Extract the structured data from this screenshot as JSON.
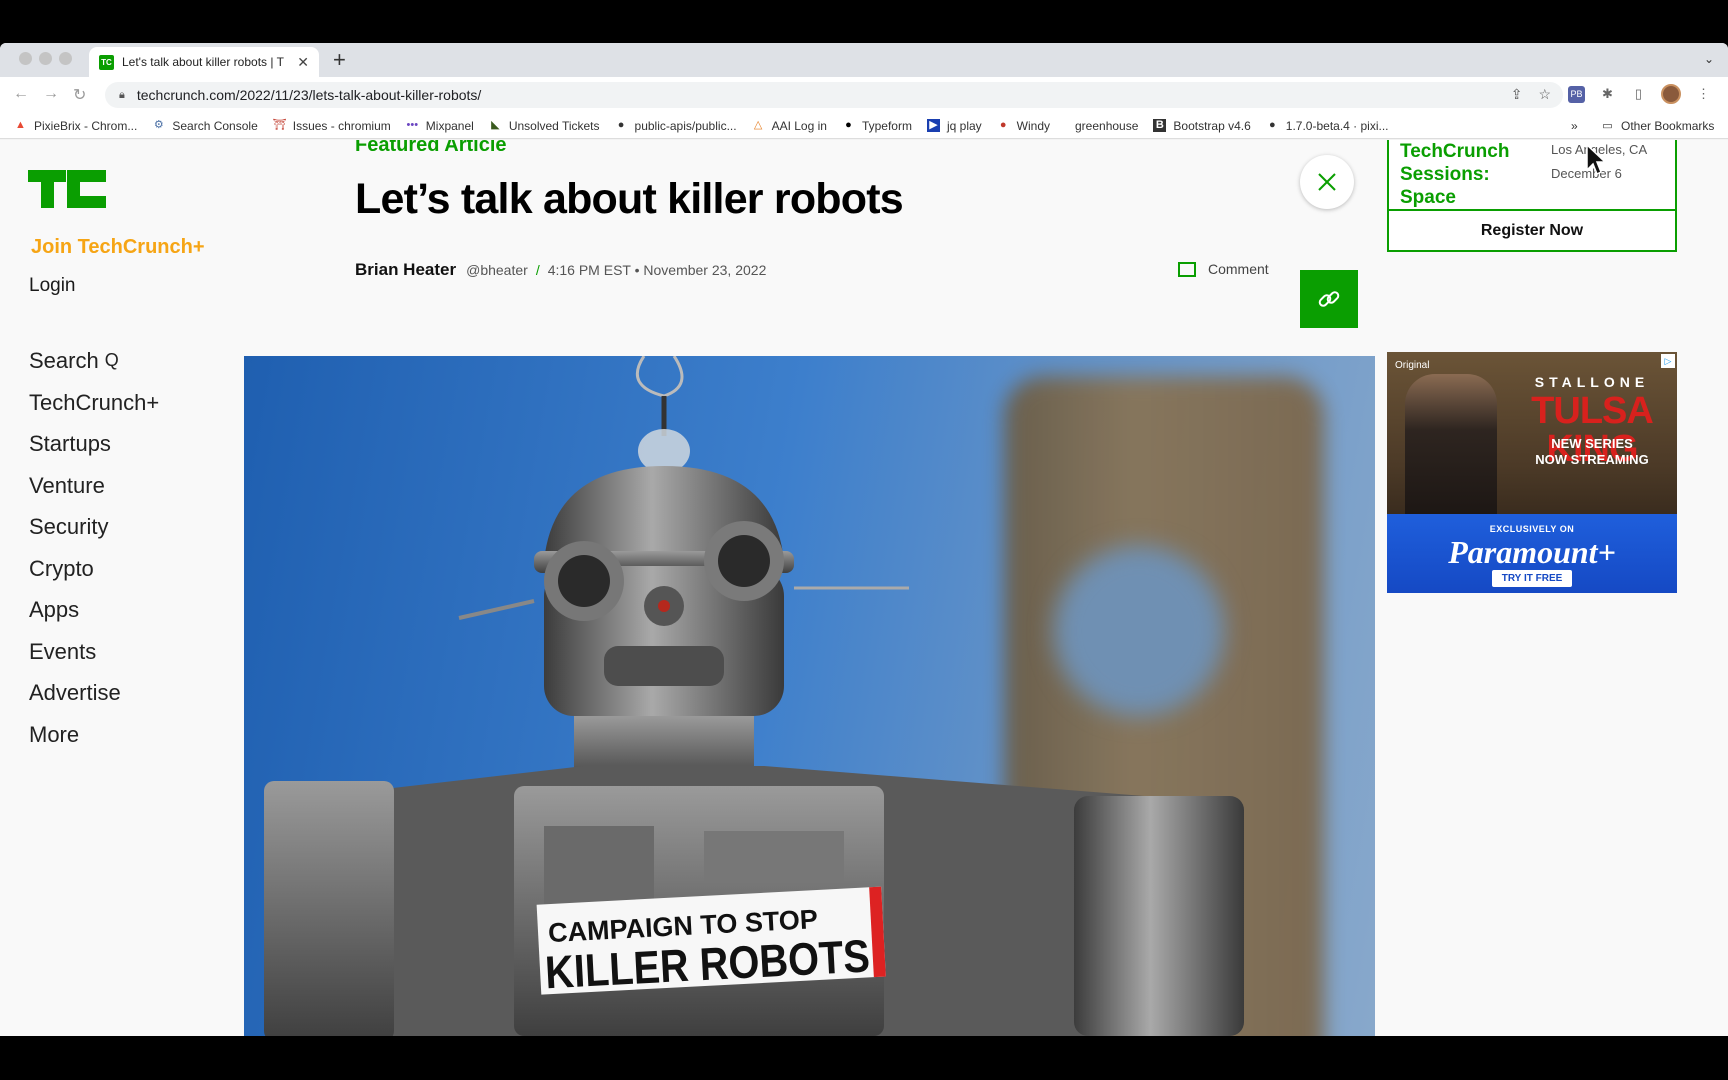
{
  "browser": {
    "tab_title": "Let's talk about killer robots | T",
    "tab_favicon": "TC",
    "url": "techcrunch.com/2022/11/23/lets-talk-about-killer-robots/",
    "bookmarks": [
      {
        "label": "PixieBrix - Chrom...",
        "icon": "pixiebrix-icon"
      },
      {
        "label": "Search Console",
        "icon": "search-console-icon"
      },
      {
        "label": "Issues - chromium",
        "icon": "chromium-issues-icon"
      },
      {
        "label": "Mixpanel",
        "icon": "mixpanel-icon"
      },
      {
        "label": "Unsolved Tickets",
        "icon": "zendesk-icon"
      },
      {
        "label": "public-apis/public...",
        "icon": "github-icon"
      },
      {
        "label": "AAI Log in",
        "icon": "aai-icon"
      },
      {
        "label": "Typeform",
        "icon": "typeform-icon"
      },
      {
        "label": "jq play",
        "icon": "jq-play-icon"
      },
      {
        "label": "Windy",
        "icon": "windy-icon"
      },
      {
        "label": "greenhouse",
        "icon": ""
      },
      {
        "label": "Bootstrap v4.6",
        "icon": "bootstrap-icon"
      },
      {
        "label": "1.7.0-beta.4 · pixi...",
        "icon": "github-icon"
      }
    ],
    "bookmarks_overflow": "»",
    "other_bookmarks": "Other Bookmarks"
  },
  "sidebar": {
    "join": "Join TechCrunch+",
    "login": "Login",
    "nav": [
      {
        "label": "Search",
        "icon": "search-icon"
      },
      {
        "label": "TechCrunch+"
      },
      {
        "label": "Startups"
      },
      {
        "label": "Venture"
      },
      {
        "label": "Security"
      },
      {
        "label": "Crypto"
      },
      {
        "label": "Apps"
      },
      {
        "label": "Events"
      },
      {
        "label": "Advertise"
      },
      {
        "label": "More"
      }
    ]
  },
  "article": {
    "kicker": "Featured Article",
    "title": "Let’s talk about killer robots",
    "author": "Brian Heater",
    "handle": "@bheater",
    "separator": "/",
    "timestamp": "4:16 PM EST • November 23, 2022",
    "comment_label": "Comment",
    "hero_sign": [
      "CAMPAIGN TO STOP",
      "KILLER ROBOTS"
    ]
  },
  "event": {
    "name_lines": [
      "TechCrunch",
      "Sessions:",
      "Space"
    ],
    "location": "Los Angeles, CA",
    "date": "December 6",
    "cta": "Register Now"
  },
  "ad": {
    "network": "Original",
    "star": "STALLONE",
    "show": "TULSA KING",
    "tagline": [
      "NEW SERIES",
      "NOW STREAMING"
    ],
    "exclusive": "EXCLUSIVELY ON",
    "brand": "Paramount+",
    "cta": "TRY IT FREE"
  },
  "colors": {
    "tc_green": "#0a9e01",
    "tc_plus_orange": "#f6a515"
  }
}
